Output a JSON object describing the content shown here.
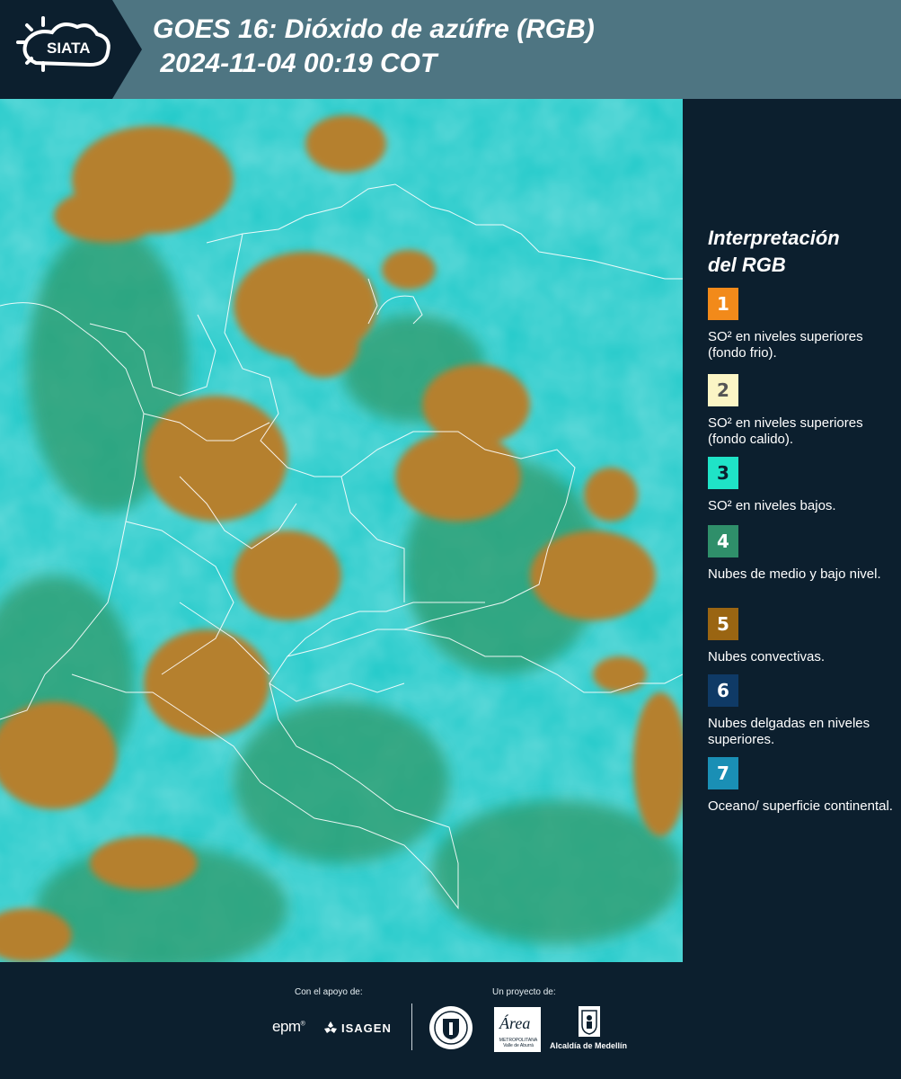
{
  "header": {
    "logo_text": "SIATA",
    "title": "GOES 16: Dióxido de azúfre (RGB)",
    "datetime": " 2024-11-04 00:19 COT"
  },
  "map": {
    "description_colors": {
      "background": "#1fc9c9",
      "convective_cloud": "#b5802f",
      "mid_low_cloud": "#2f9a6a",
      "borders": "#ffffff"
    }
  },
  "legend": {
    "title_line1": "Interpretación",
    "title_line2": "del RGB",
    "items": [
      {
        "number": "1",
        "color": "#f28a1a",
        "text_color": "#ffffff",
        "description": "SO² en niveles superiores (fondo frio)."
      },
      {
        "number": "2",
        "color": "#fbf5c5",
        "text_color": "#555555",
        "description": "SO² en niveles superiores (fondo calido)."
      },
      {
        "number": "3",
        "color": "#1fe3c7",
        "text_color": "#0c1f2e",
        "description": "SO² en niveles bajos."
      },
      {
        "number": "4",
        "color": "#2f8f6a",
        "text_color": "#ffffff",
        "description": "Nubes de medio y bajo nivel."
      },
      {
        "number": "5",
        "color": "#9a6512",
        "text_color": "#ffffff",
        "description": "Nubes convectivas."
      },
      {
        "number": "6",
        "color": "#0f3a66",
        "text_color": "#ffffff",
        "description": "Nubes delgadas en niveles superiores."
      },
      {
        "number": "7",
        "color": "#1a8fb5",
        "text_color": "#ffffff",
        "description": "Oceano/ superficie continental."
      }
    ]
  },
  "footer": {
    "support_label": "Con el apoyo de:",
    "project_label": "Un proyecto de:",
    "epm": "epm",
    "epm_mark": "®",
    "isagen": "ISAGEN",
    "area_word": "Área",
    "area_sub": "METROPOLITANA Valle de Aburrá",
    "alcaldia": "Alcaldía de Medellín"
  }
}
